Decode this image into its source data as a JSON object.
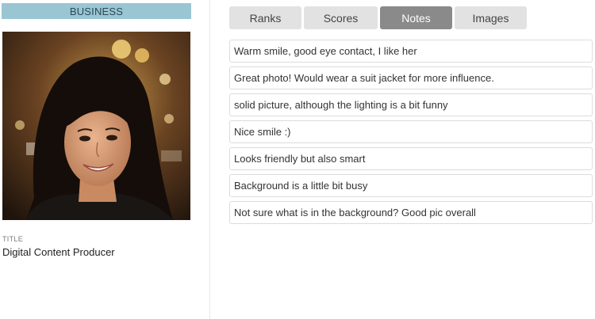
{
  "profile": {
    "category": "BUSINESS",
    "title_label": "TITLE",
    "title_value": "Digital Content Producer"
  },
  "tabs": [
    {
      "label": "Ranks",
      "active": false
    },
    {
      "label": "Scores",
      "active": false
    },
    {
      "label": "Notes",
      "active": true
    },
    {
      "label": "Images",
      "active": false
    }
  ],
  "notes": [
    "Warm smile, good eye contact, I like her",
    "Great photo! Would wear a suit jacket for more influence.",
    "solid picture, although the lighting is a bit funny",
    "Nice smile :)",
    "Looks friendly but also smart",
    "Background is a little bit busy",
    "Not sure what is in the background? Good pic overall"
  ],
  "colors": {
    "banner": "#9ac5d3",
    "tab_inactive": "#e2e2e2",
    "tab_active": "#8a8a8a"
  }
}
